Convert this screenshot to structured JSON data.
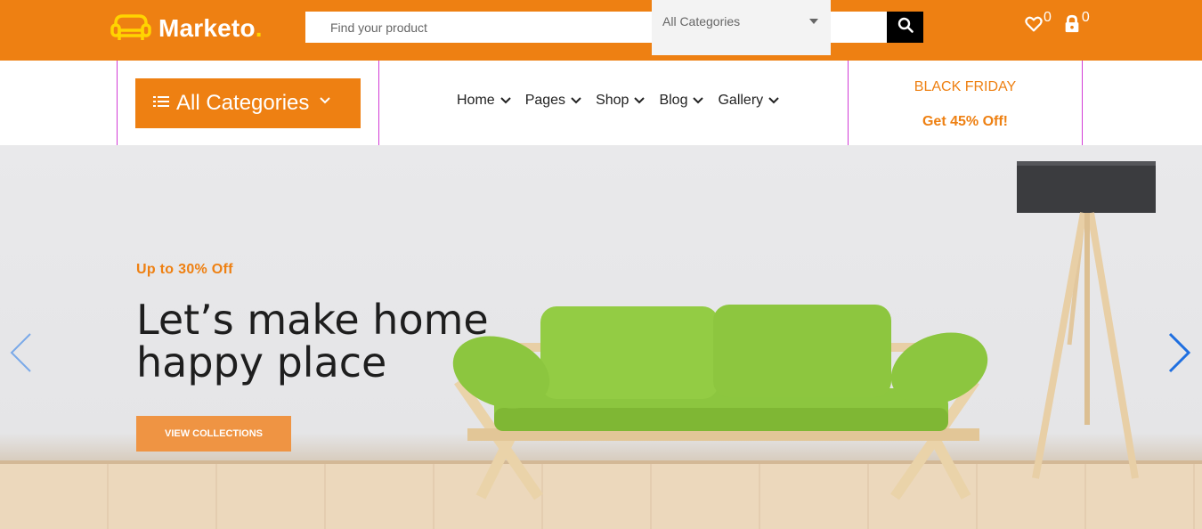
{
  "header": {
    "logo_text": "Marketo",
    "logo_dot": ".",
    "search_placeholder": "Find your product",
    "category_select": "All Categories",
    "wishlist_count": "0",
    "cart_count": "0"
  },
  "nav": {
    "all_categories_label": "All Categories",
    "menu": [
      {
        "label": "Home"
      },
      {
        "label": "Pages"
      },
      {
        "label": "Shop"
      },
      {
        "label": "Blog"
      },
      {
        "label": "Gallery"
      }
    ],
    "promo_title": "BLACK FRIDAY",
    "promo_subtitle": "Get 45% Off!"
  },
  "hero": {
    "offer": "Up to 30% Off",
    "title_line1": "Let’s make home",
    "title_line2": "happy place",
    "button_label": "VIEW COLLECTIONS"
  },
  "colors": {
    "brand_orange": "#ee8012",
    "logo_yellow": "#ffd400",
    "sofa_green": "#8dc63f",
    "arrow_blue": "#1f6fe0"
  },
  "icons": {
    "logo": "sofa-logo-icon",
    "search": "search-icon",
    "wishlist": "heart-icon",
    "cart": "lock-bag-icon",
    "menu": "hamburger-icon",
    "prev": "chevron-left-icon",
    "next": "chevron-right-icon"
  }
}
